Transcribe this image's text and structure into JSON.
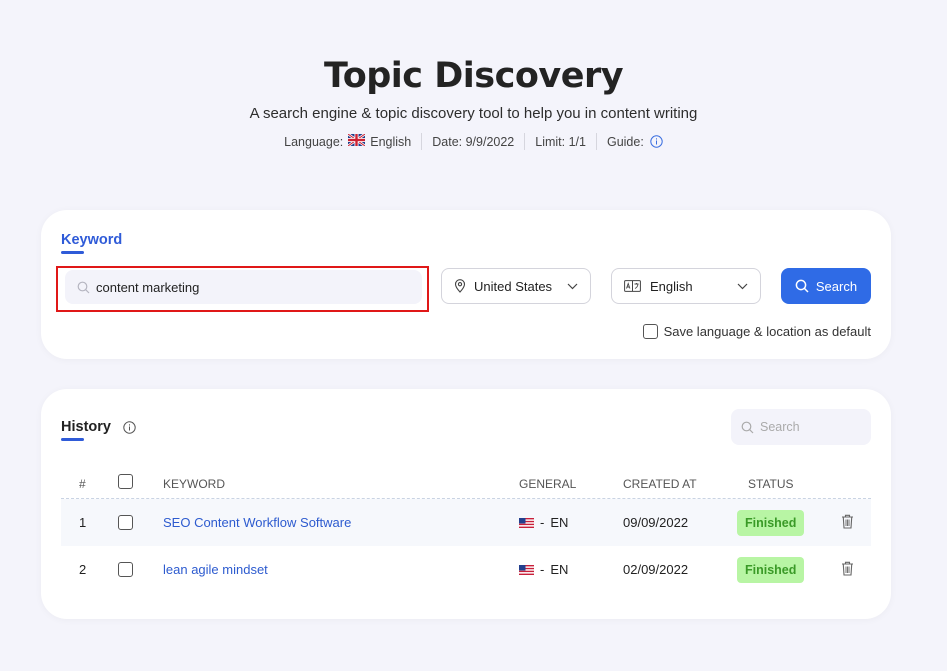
{
  "header": {
    "title": "Topic Discovery",
    "subtitle": "A search engine & topic discovery tool to help you in content writing",
    "language_label": "Language:",
    "language_value": "English",
    "date_label": "Date: 9/9/2022",
    "limit_label": "Limit: 1/1",
    "guide_label": "Guide:"
  },
  "keyword_card": {
    "tab_label": "Keyword",
    "search_value": "content marketing",
    "country": "United States",
    "language": "English",
    "search_button": "Search",
    "save_default_label": "Save language & location as default"
  },
  "history": {
    "title": "History",
    "search_placeholder": "Search",
    "columns": {
      "num": "#",
      "keyword": "KEYWORD",
      "general": "GENERAL",
      "created_at": "CREATED AT",
      "status": "STATUS"
    },
    "rows": [
      {
        "num": "1",
        "keyword": "SEO Content Workflow Software",
        "lang": "EN",
        "created_at": "09/09/2022",
        "status": "Finished"
      },
      {
        "num": "2",
        "keyword": "lean agile mindset",
        "lang": "EN",
        "created_at": "02/09/2022",
        "status": "Finished"
      }
    ]
  },
  "colors": {
    "accent": "#2f6be6",
    "link": "#2d5bcf",
    "status_bg": "#b8f5a4",
    "status_text": "#3a9a27",
    "highlight": "#e01818"
  }
}
